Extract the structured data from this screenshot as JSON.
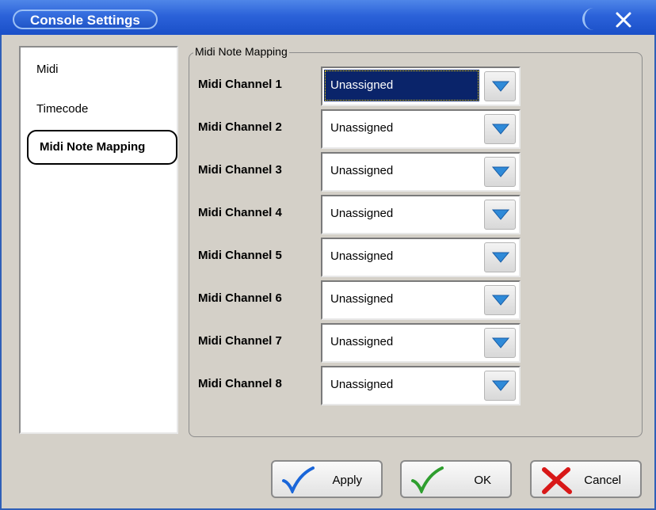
{
  "window": {
    "title": "Console Settings"
  },
  "sidebar": {
    "items": [
      {
        "label": "Midi"
      },
      {
        "label": "Timecode"
      },
      {
        "label": "Midi Note Mapping"
      }
    ]
  },
  "group": {
    "title": "Midi Note Mapping",
    "rows": [
      {
        "label": "Midi Channel 1",
        "value": "Unassigned"
      },
      {
        "label": "Midi Channel 2",
        "value": "Unassigned"
      },
      {
        "label": "Midi Channel 3",
        "value": "Unassigned"
      },
      {
        "label": "Midi Channel 4",
        "value": "Unassigned"
      },
      {
        "label": "Midi Channel 5",
        "value": "Unassigned"
      },
      {
        "label": "Midi Channel 6",
        "value": "Unassigned"
      },
      {
        "label": "Midi Channel 7",
        "value": "Unassigned"
      },
      {
        "label": "Midi Channel 8",
        "value": "Unassigned"
      }
    ]
  },
  "buttons": {
    "apply": "Apply",
    "ok": "OK",
    "cancel": "Cancel"
  },
  "colors": {
    "title_bar": "#2b62d9",
    "selection": "#0a246a",
    "apply_check": "#1a66d9",
    "ok_check": "#2e9e2e",
    "cancel_x": "#d81818"
  },
  "icons": {
    "close": "close-icon",
    "dropdown": "chevron-down-icon",
    "apply": "checkmark-icon",
    "cancel": "x-icon"
  }
}
